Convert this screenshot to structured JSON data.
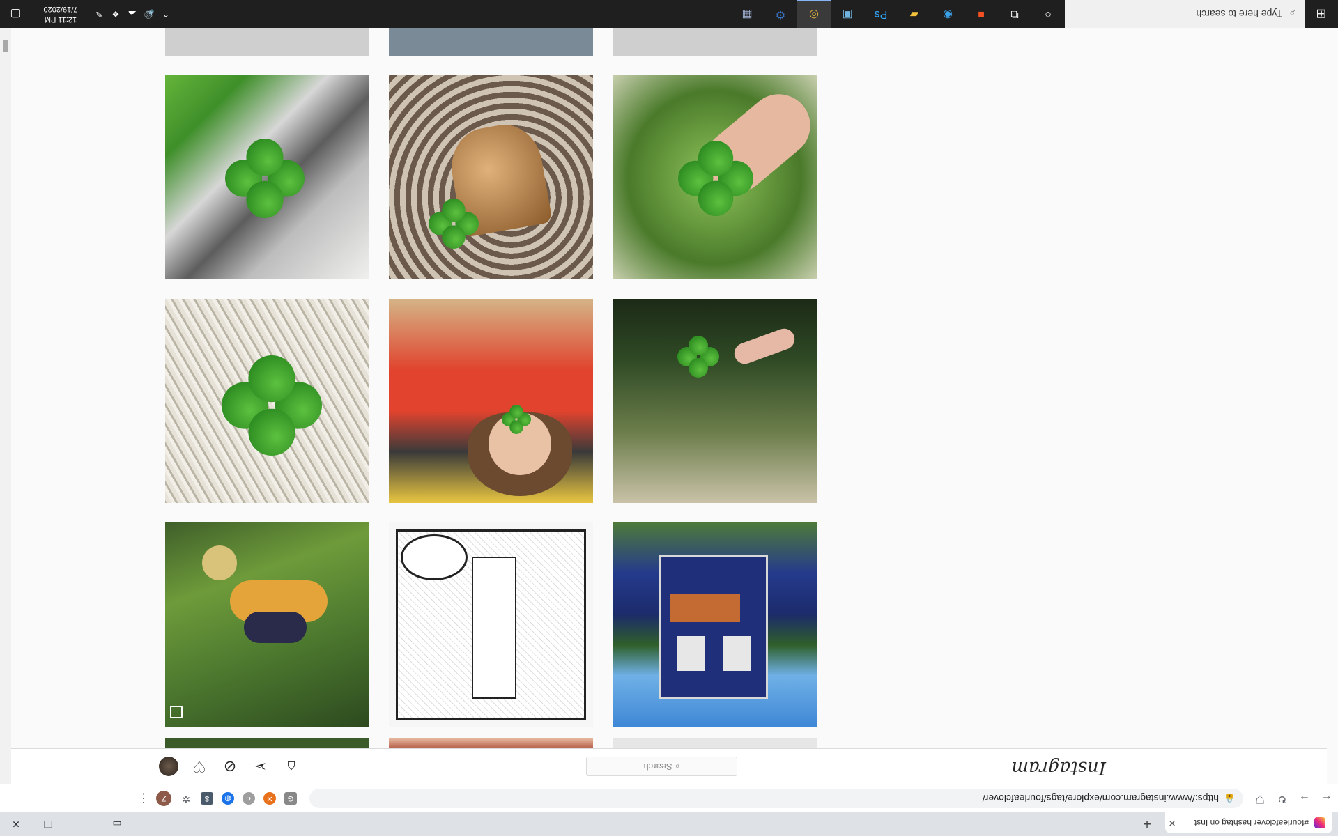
{
  "browser": {
    "tab_title": "#fourleafclover hashtag on Inst",
    "url": "https://www.instagram.com/explore/tags/fourleafclover/",
    "profile_initial": "Z"
  },
  "instagram": {
    "logo": "Instagram",
    "search_placeholder": "Search"
  },
  "taskbar": {
    "search_placeholder": "Type here to search",
    "time": "12:11 PM",
    "date": "7/19/2020"
  },
  "colors": {
    "clover_green": "#2f9a2a",
    "taskbar_bg": "#1f1f1f",
    "page_bg": "#fafafa"
  }
}
